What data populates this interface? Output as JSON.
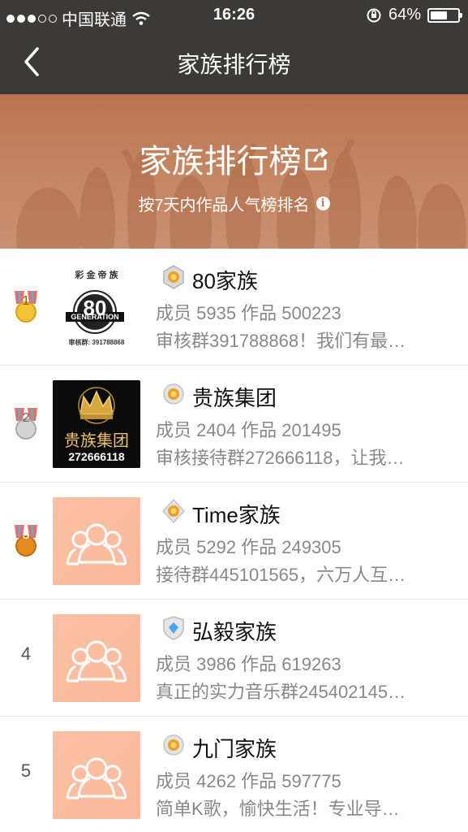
{
  "status_bar": {
    "carrier": "中国联通",
    "time": "16:26",
    "battery_percent_text": "64%",
    "battery_level": 0.64
  },
  "nav": {
    "title": "家族排行榜"
  },
  "banner": {
    "title": "家族排行榜",
    "subtitle": "按7天内作品人气榜排名"
  },
  "families": [
    {
      "rank": "1",
      "name": "80家族",
      "stats": "成员 5935 作品 500223",
      "desc": "审核群391788868！我们有最…",
      "thumb": "logo-80"
    },
    {
      "rank": "2",
      "name": "贵族集团",
      "stats": "成员 2404 作品 201495",
      "desc": "审核接待群272666118，让我…",
      "thumb": "logo-guizu"
    },
    {
      "rank": "3",
      "name": "Time家族",
      "stats": "成员 5292 作品 249305",
      "desc": "接待群445101565，六万人互…",
      "thumb": "placeholder"
    },
    {
      "rank": "4",
      "name": "弘毅家族",
      "stats": "成员 3986 作品 619263",
      "desc": "真正的实力音乐群245402145…",
      "thumb": "placeholder"
    },
    {
      "rank": "5",
      "name": "九门家族",
      "stats": "成员 4262 作品 597775",
      "desc": "简单K歌，愉快生活！专业导…",
      "thumb": "placeholder"
    }
  ],
  "thumb_texts": {
    "logo80_top": "彩 金 帝 族",
    "logo80_badge": "80",
    "logo80_banner": "GENERATION",
    "logo80_qq": "审核群: 391788868",
    "guizu_name": "贵族集团",
    "guizu_number": "272666118"
  }
}
